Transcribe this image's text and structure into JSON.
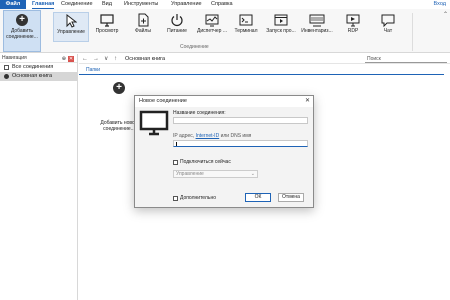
{
  "menu": {
    "file": "Файл",
    "tabs": [
      "Главная",
      "Соединение",
      "Вид",
      "Инструменты",
      "Управление",
      "Справка"
    ],
    "login": "Вход"
  },
  "ribbon": {
    "add_connection": "Добавить соединение...",
    "buttons": [
      "Управление",
      "Просмотр",
      "Файлы",
      "Питание",
      "Диспетчер ...",
      "Терминал",
      "Запуск про...",
      "Инвентариз...",
      "RDP",
      "Чат"
    ],
    "group_label": "Соединение"
  },
  "nav": {
    "title": "Навигация",
    "items": [
      "Все соединения",
      "Основная книга"
    ]
  },
  "addressbar": {
    "path": "Основная книга",
    "search_placeholder": "Поиск"
  },
  "folders": {
    "label": "Папки"
  },
  "tile": {
    "label": "Добавить новое соединение..."
  },
  "dialog": {
    "title": "Новое соединение",
    "name_label": "Название соединения:",
    "name_value": "",
    "address_prefix": "IP адрес, ",
    "address_link": "Internet-ID",
    "address_suffix": " или DNS имя",
    "address_value": "",
    "connect_now": "Подключиться сейчас",
    "mode_value": "Управление",
    "advanced": "Дополнительно",
    "ok": "ОК",
    "cancel": "Отмена"
  }
}
